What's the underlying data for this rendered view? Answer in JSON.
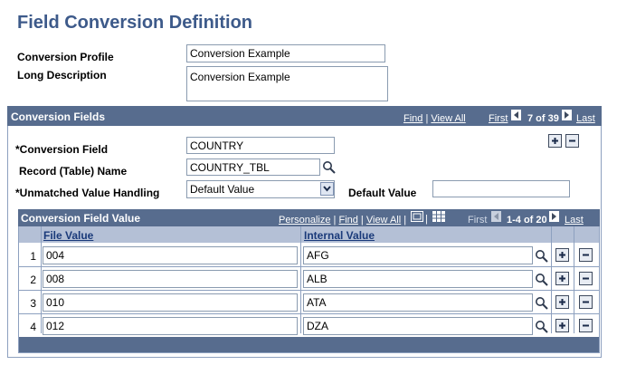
{
  "page": {
    "title": "Field Conversion Definition"
  },
  "header_fields": {
    "conversion_profile_label": "Conversion Profile",
    "conversion_profile_value": "Conversion Example",
    "long_description_label": "Long Description",
    "long_description_value": "Conversion Example"
  },
  "conversion_fields": {
    "title": "Conversion Fields",
    "find": "Find",
    "view_all": "View All",
    "first": "First",
    "range": "7 of 39",
    "last": "Last",
    "conversion_field_label": "*Conversion Field",
    "conversion_field_value": "COUNTRY",
    "record_name_label": "Record (Table) Name",
    "record_name_value": "COUNTRY_TBL",
    "unmatched_label": "*Unmatched Value Handling",
    "unmatched_value": "Default Value",
    "default_value_label": "Default Value",
    "default_value_value": ""
  },
  "grid": {
    "title": "Conversion Field Value",
    "personalize": "Personalize",
    "find": "Find",
    "view_all": "View All",
    "first": "First",
    "range": "1-4 of 20",
    "last": "Last",
    "col_file": "File Value",
    "col_internal": "Internal Value",
    "rows": [
      {
        "num": "1",
        "file": "004",
        "internal": "AFG"
      },
      {
        "num": "2",
        "file": "008",
        "internal": "ALB"
      },
      {
        "num": "3",
        "file": "010",
        "internal": "ATA"
      },
      {
        "num": "4",
        "file": "012",
        "internal": "DZA"
      }
    ]
  },
  "icons": {
    "prev": "left-arrow-icon",
    "next": "right-arrow-icon",
    "add": "plus-icon",
    "delete": "minus-icon",
    "lookup": "magnifier-icon",
    "dropdown": "chevron-down-icon"
  },
  "colors": {
    "title": "#3d5a8a",
    "band": "#576c8e",
    "grid_header": "#b4c0d6"
  }
}
